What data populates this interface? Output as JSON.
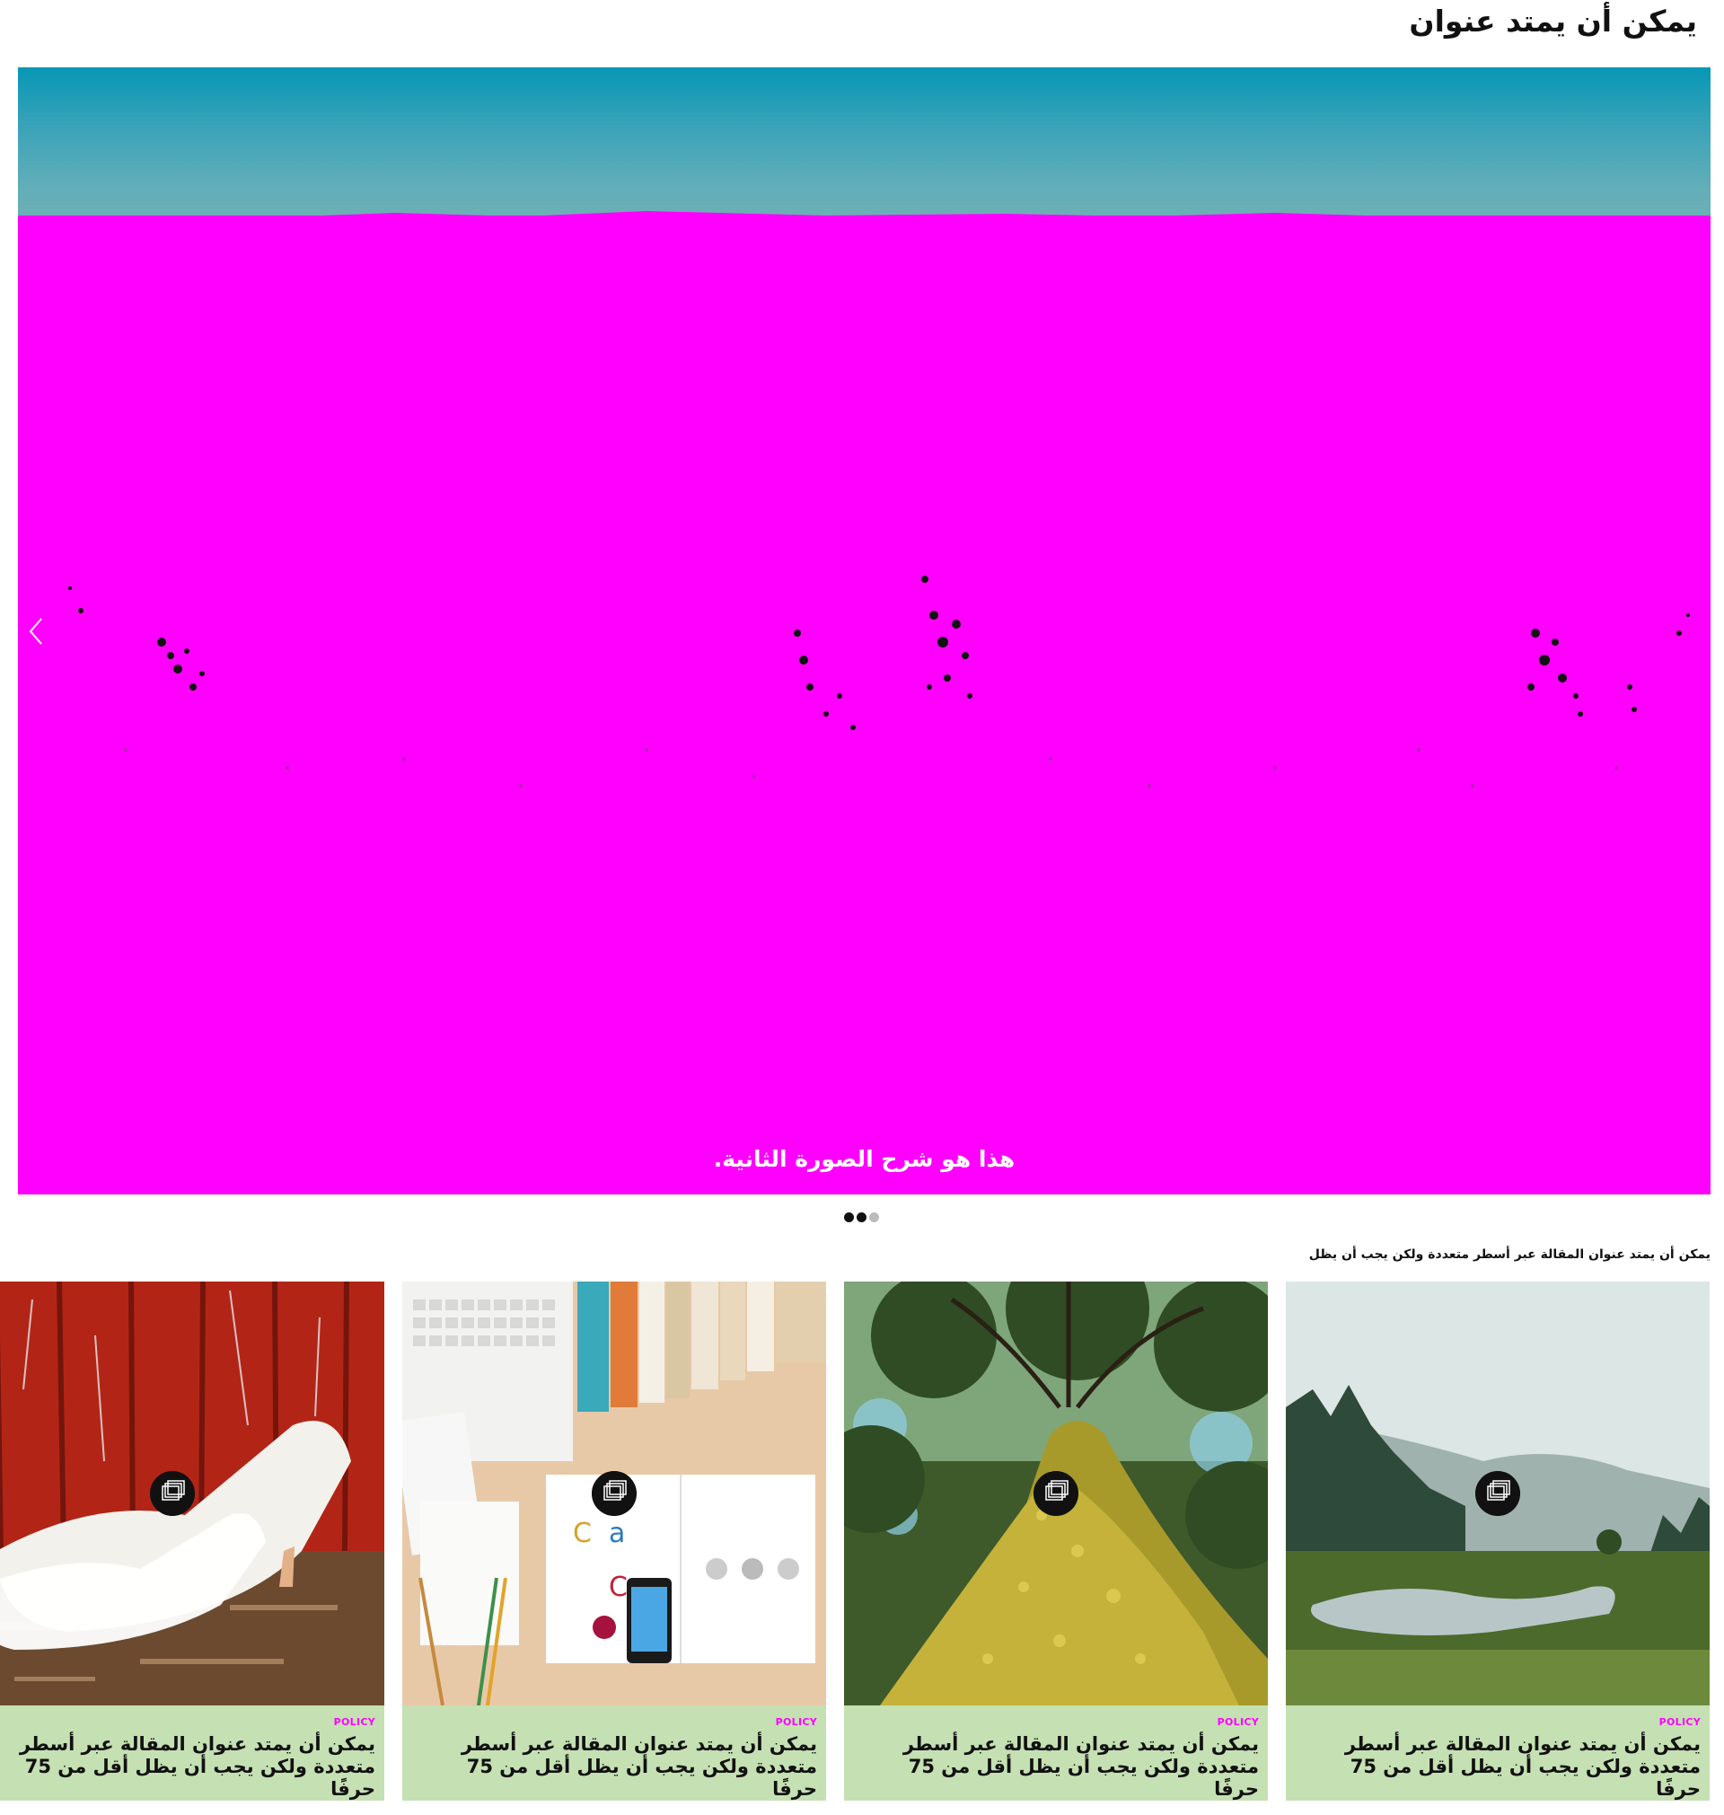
{
  "block": {
    "title": "يمكن أن يمتد عنوان"
  },
  "slider": {
    "caption": "هذا هو شرح الصورة الثانية.",
    "prev_icon": "chevron-left-icon",
    "dots": [
      {
        "state": "active",
        "color": "#111111"
      },
      {
        "state": "active",
        "color": "#111111"
      },
      {
        "state": "inactive",
        "color": "#bbbbbb"
      }
    ]
  },
  "teaser": {
    "text": "يمكن أن يمتد عنوان المقالة عبر أسطر متعددة ولكن يجب أن يظل"
  },
  "cards": [
    {
      "category": "POLICY",
      "title": "يمكن أن يمتد عنوان المقالة عبر أسطر متعددة ولكن يجب أن يظل أقل من 75 حرفًا",
      "image": "red-wall-white-heels",
      "icon": "gallery-icon"
    },
    {
      "category": "POLICY",
      "title": "يمكن أن يمتد عنوان المقالة عبر أسطر متعددة ولكن يجب أن يظل أقل من 75 حرفًا",
      "image": "desk-keyboard-books-logos",
      "icon": "gallery-icon"
    },
    {
      "category": "POLICY",
      "title": "يمكن أن يمتد عنوان المقالة عبر أسطر متعددة ولكن يجب أن يظل أقل من 75 حرفًا",
      "image": "mossy-tree-trunk",
      "icon": "gallery-icon"
    },
    {
      "category": "POLICY",
      "title": "يمكن أن يمتد عنوان المقالة عبر أسطر متعددة ولكن يجب أن يظل أقل من 75 حرفًا",
      "image": "misty-lake-meadow",
      "icon": "gallery-icon"
    }
  ],
  "colors": {
    "accent": "#ff00ff",
    "card_background": "#c5e0b3",
    "sky": "#0797b5"
  }
}
